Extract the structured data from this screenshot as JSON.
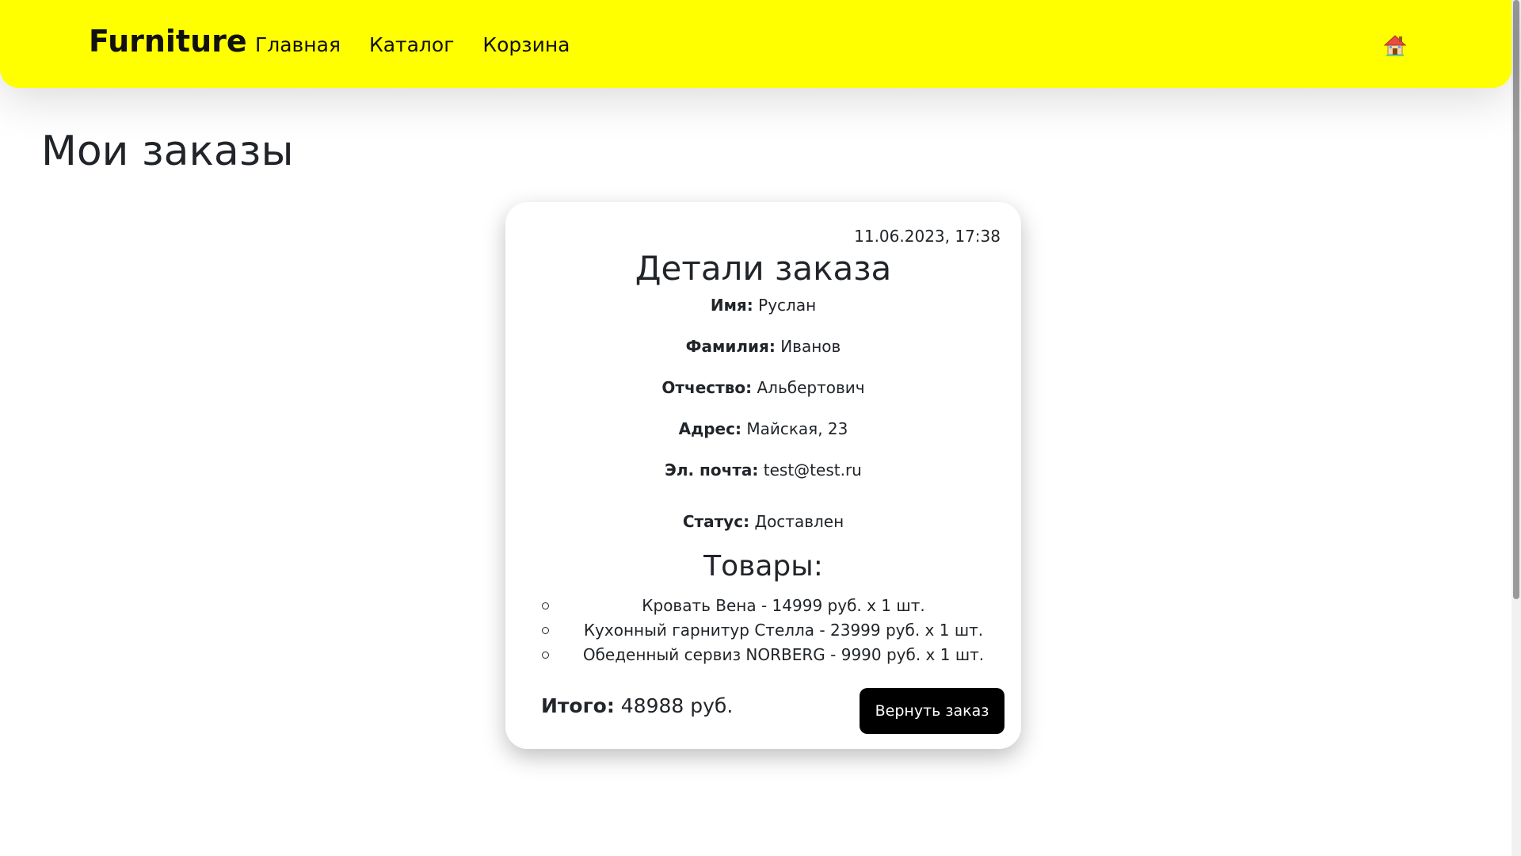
{
  "navbar": {
    "brand": "Furniture",
    "links": [
      "Главная",
      "Каталог",
      "Корзина"
    ],
    "home_icon": "house-icon",
    "background_color": "#ffff00"
  },
  "page": {
    "title": "Мои заказы"
  },
  "order": {
    "date": "11.06.2023, 17:38",
    "title": "Детали заказа",
    "fields": [
      {
        "label": "Имя:",
        "value": "Руслан"
      },
      {
        "label": "Фамилия:",
        "value": "Иванов"
      },
      {
        "label": "Отчество:",
        "value": "Альбертович"
      },
      {
        "label": "Адрес:",
        "value": "Майская, 23"
      },
      {
        "label": "Эл. почта:",
        "value": "test@test.ru"
      },
      {
        "label": "Статус:",
        "value": "Доставлен"
      }
    ],
    "goods_title": "Товары:",
    "goods": [
      "Кровать Вена - 14999 руб. x 1 шт.",
      "Кухонный гарнитур Стелла - 23999 руб. x 1 шт.",
      "Обеденный сервиз NORBERG - 9990 руб. x 1 шт."
    ],
    "total_label": "Итого:",
    "total_value": "48988 руб.",
    "return_button": "Вернуть заказ",
    "button_color": "#000000"
  }
}
